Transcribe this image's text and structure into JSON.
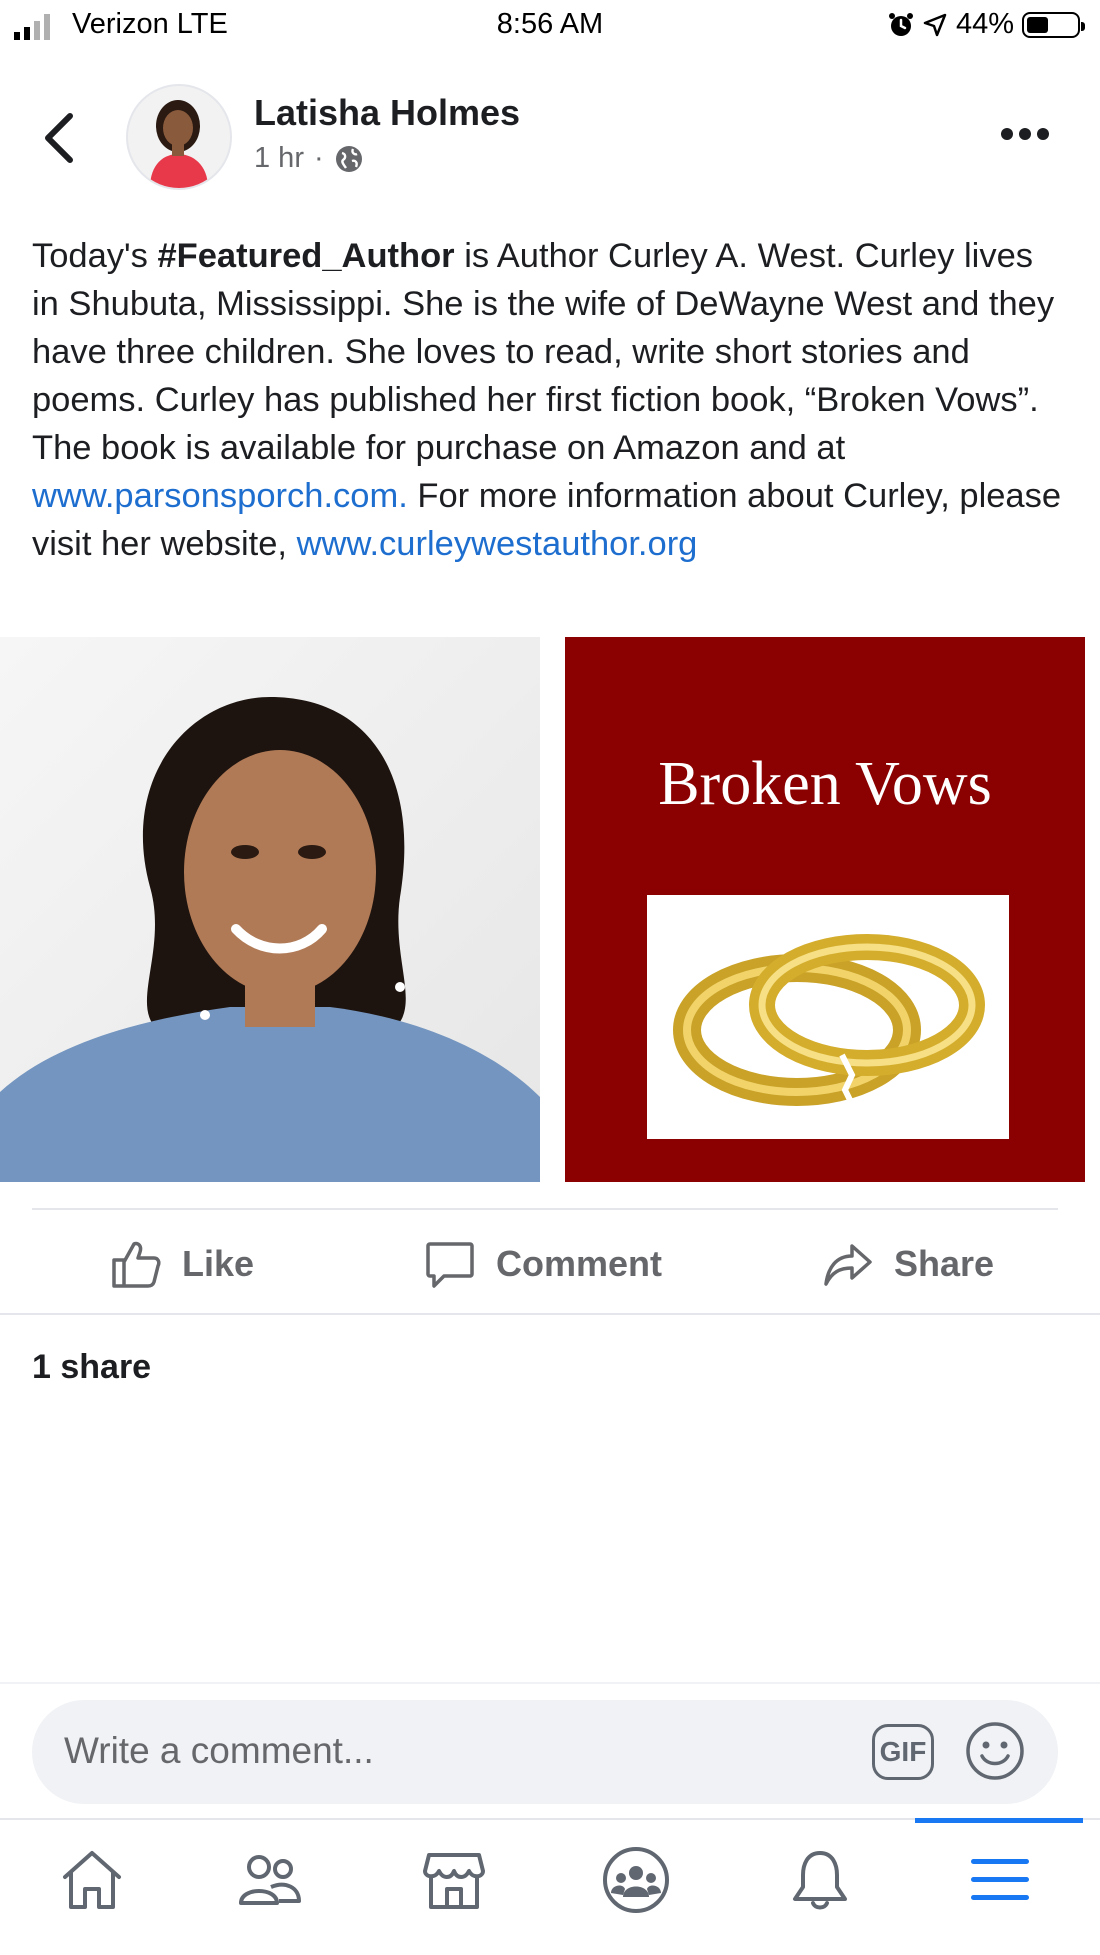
{
  "status_bar": {
    "carrier": "Verizon LTE",
    "time": "8:56 AM",
    "battery": "44%",
    "battery_level": 0.44
  },
  "post": {
    "author": "Latisha Holmes",
    "time": "1 hr",
    "separator": "·",
    "text_parts": {
      "p1": "Today's ",
      "hashtag": "#Featured_Author",
      "p2": " is Author Curley A. West. Curley lives in Shubuta, Mississippi. She is the wife of DeWayne West and they have three children. She loves to read, write short stories and poems. Curley has published her first fiction book, “Broken Vows”. The book is available for purchase on Amazon and at ",
      "link1": "www.parsonsporch.com.",
      "p3": " For more information about Curley, please visit her website, ",
      "link2": "www.curleywestauthor.org"
    },
    "book_cover_title": "Broken Vows",
    "share_count": "1 share"
  },
  "actions": {
    "like": "Like",
    "comment": "Comment",
    "share": "Share"
  },
  "comment_box": {
    "placeholder": "Write a comment...",
    "gif_label": "GIF"
  },
  "colors": {
    "link": "#1d6ecf",
    "accent": "#1877f2",
    "muted": "#65676b",
    "book_red": "#8b0000"
  },
  "nav": {
    "items": [
      "home-icon",
      "friends-icon",
      "marketplace-icon",
      "groups-icon",
      "notifications-icon",
      "menu-icon"
    ],
    "active": "menu-icon"
  }
}
